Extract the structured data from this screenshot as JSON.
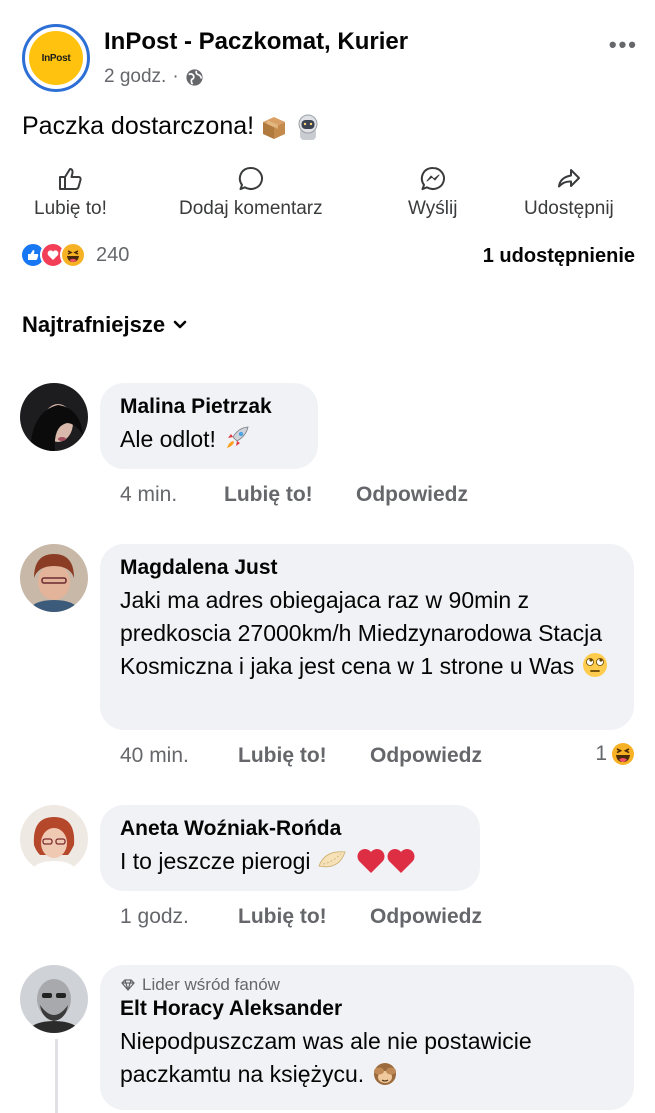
{
  "post": {
    "page_name": "InPost - Paczkomat, Kurier",
    "logo_text": "InPost",
    "time": "2 godz.",
    "separator": "·",
    "text": "Paczka dostarczona!",
    "emojis": [
      "package-icon",
      "astronaut-icon"
    ]
  },
  "actions": {
    "like": "Lubię to!",
    "comment": "Dodaj komentarz",
    "send": "Wyślij",
    "share": "Udostępnij"
  },
  "reactions": {
    "count": "240",
    "types": [
      "like",
      "love",
      "haha"
    ],
    "shares": "1 udostępnienie"
  },
  "sort_label": "Najtrafniejsze",
  "comments": [
    {
      "name": "Malina Pietrzak",
      "text": "Ale odlot!",
      "emoji": "rocket-icon",
      "time": "4 min.",
      "like": "Lubię to!",
      "reply": "Odpowiedz"
    },
    {
      "name": "Magdalena Just",
      "text": "Jaki ma adres obiegajaca raz w 90min z predkoscia 27000km/h Miedzynarodowa Stacja Kosmiczna i jaka jest cena w 1 strone u Was",
      "emoji": "rolling-eyes-icon",
      "time": "40 min.",
      "like": "Lubię to!",
      "reply": "Odpowiedz",
      "reaction_count": "1",
      "reaction_type": "haha"
    },
    {
      "name": "Aneta Woźniak-Rońda",
      "text": "I to jeszcze pierogi",
      "emoji": "dumpling-icon hearts-icon",
      "time": "1 godz.",
      "like": "Lubię to!",
      "reply": "Odpowiedz"
    },
    {
      "badge": "Lider wśród fanów",
      "name": "Elt Horacy Aleksander",
      "text": "Niepodpuszczam was ale nie postawicie paczkamtu na księżycu.",
      "emoji": "see-no-evil-monkey-icon"
    }
  ],
  "colors": {
    "accent": "#1877f2",
    "bubble": "#f0f2f5",
    "muted": "#65676b",
    "logo": "#ffc20e"
  }
}
